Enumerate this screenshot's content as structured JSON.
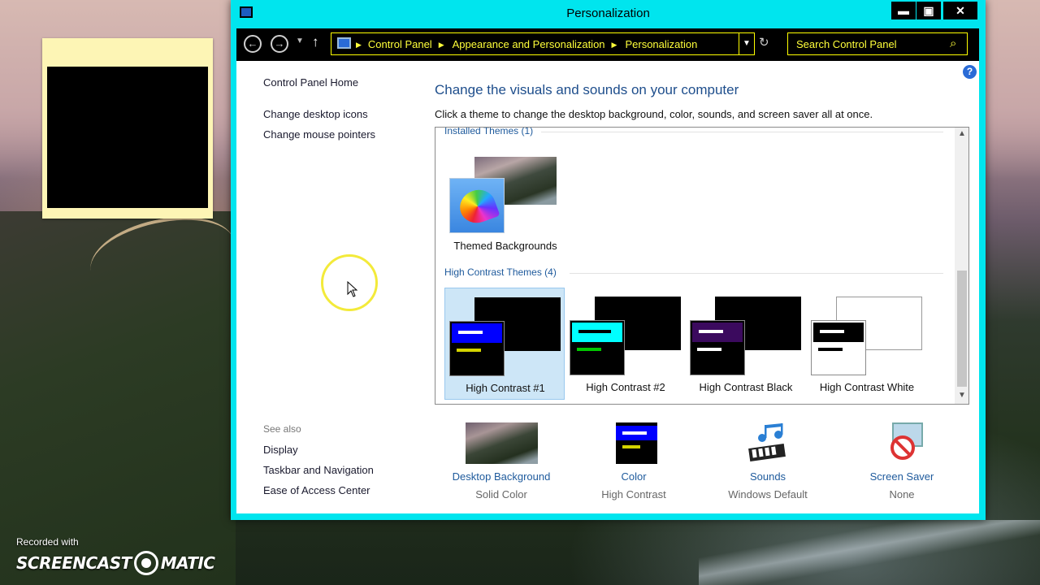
{
  "window": {
    "title": "Personalization",
    "controls": {
      "minimize": "▬",
      "maximize": "▣",
      "close": "✕"
    }
  },
  "address_bar": {
    "breadcrumbs": [
      "Control Panel",
      "Appearance and Personalization",
      "Personalization"
    ],
    "search_placeholder": "Search Control Panel"
  },
  "sidebar": {
    "home_link": "Control Panel Home",
    "links": [
      "Change desktop icons",
      "Change mouse pointers"
    ],
    "see_also_label": "See also",
    "see_also_links": [
      "Display",
      "Taskbar and Navigation",
      "Ease of Access Center"
    ]
  },
  "main": {
    "heading": "Change the visuals and sounds on your computer",
    "subheading": "Click a theme to change the desktop background, color, sounds, and screen saver all at once."
  },
  "themes": {
    "installed_header": "Installed Themes (1)",
    "installed": [
      {
        "name": "Themed Backgrounds"
      }
    ],
    "high_contrast_header": "High Contrast Themes (4)",
    "high_contrast": [
      {
        "name": "High Contrast #1",
        "selected": true,
        "bar_color": "#0000ff",
        "line1": "#ffffff",
        "line2": "#d4d400",
        "back": "#000000",
        "front": "#000000"
      },
      {
        "name": "High Contrast #2",
        "selected": false,
        "bar_color": "#00ffff",
        "line1": "#000000",
        "line2": "#00c800",
        "back": "#000000",
        "front": "#000000"
      },
      {
        "name": "High Contrast Black",
        "selected": false,
        "bar_color": "#3b0a5e",
        "line1": "#ffffff",
        "line2": "#ffffff",
        "back": "#000000",
        "front": "#000000"
      },
      {
        "name": "High Contrast White",
        "selected": false,
        "bar_color": "#000000",
        "line1": "#ffffff",
        "line2": "#000000",
        "back": "#ffffff",
        "front": "#ffffff"
      }
    ]
  },
  "settings": [
    {
      "label": "Desktop Background",
      "value": "Solid Color",
      "icon": "landscape-icon"
    },
    {
      "label": "Color",
      "value": "High Contrast",
      "icon": "color-icon"
    },
    {
      "label": "Sounds",
      "value": "Windows Default",
      "icon": "music-notes-icon"
    },
    {
      "label": "Screen Saver",
      "value": "None",
      "icon": "no-screensaver-icon"
    }
  ],
  "watermark": {
    "recorded_with": "Recorded with",
    "brand_left": "SCREENCAST",
    "brand_right": "MATIC"
  },
  "colors": {
    "window_frame": "#00e5ee",
    "address_bar_bg": "#000000",
    "address_text": "#ffff3a",
    "link_blue": "#1e5a9c",
    "selection": "#cde6f7"
  }
}
